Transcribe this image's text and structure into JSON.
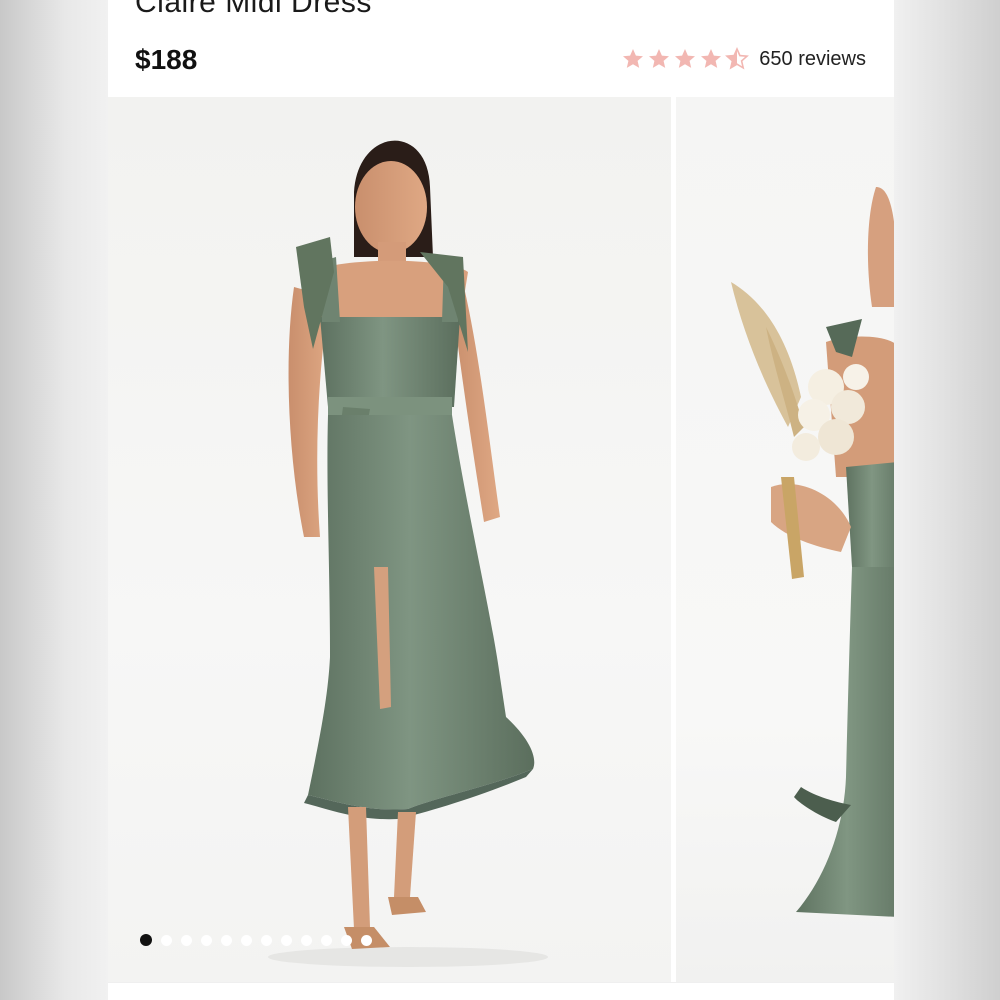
{
  "product": {
    "title": "Claire Midi Dress",
    "price": "$188",
    "rating": 4.5,
    "review_count_label": "650 reviews",
    "star_color": "#f2b7b2"
  },
  "gallery": {
    "total_images": 12,
    "active_index": 0,
    "dress_color": "#6f8471"
  }
}
